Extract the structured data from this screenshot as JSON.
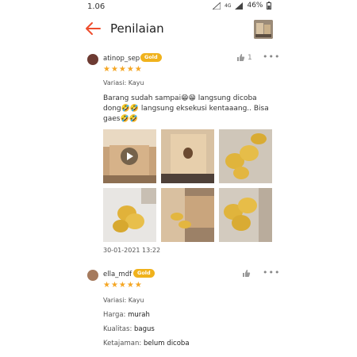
{
  "status": {
    "time": "1.06",
    "network": "4G",
    "battery": "46%"
  },
  "header": {
    "title": "Penilaian"
  },
  "reviews": [
    {
      "user": "atinop_sep",
      "badge": "Gold",
      "likes": "1",
      "stars": "★★★★★",
      "variant": "Variasi: Kayu",
      "text": "Barang sudah sampai😁😁 langsung dicoba dong🤣🤣 langsung eksekusi kentaaang.. Bisa gaes🤣🤣",
      "date": "30-01-2021 13:22"
    },
    {
      "user": "ella_mdf",
      "badge": "Gold",
      "stars": "★★★★★",
      "variant": "Variasi: Kayu",
      "harga_label": "Harga:",
      "harga_value": "murah",
      "kualitas_label": "Kualitas:",
      "kualitas_value": "bagus",
      "ketajaman_label": "Ketajaman:",
      "ketajaman_value": "belum dicoba"
    }
  ],
  "colors": {
    "accent": "#ee4d2d",
    "gold": "#f0b21c",
    "star": "#f5a623"
  }
}
